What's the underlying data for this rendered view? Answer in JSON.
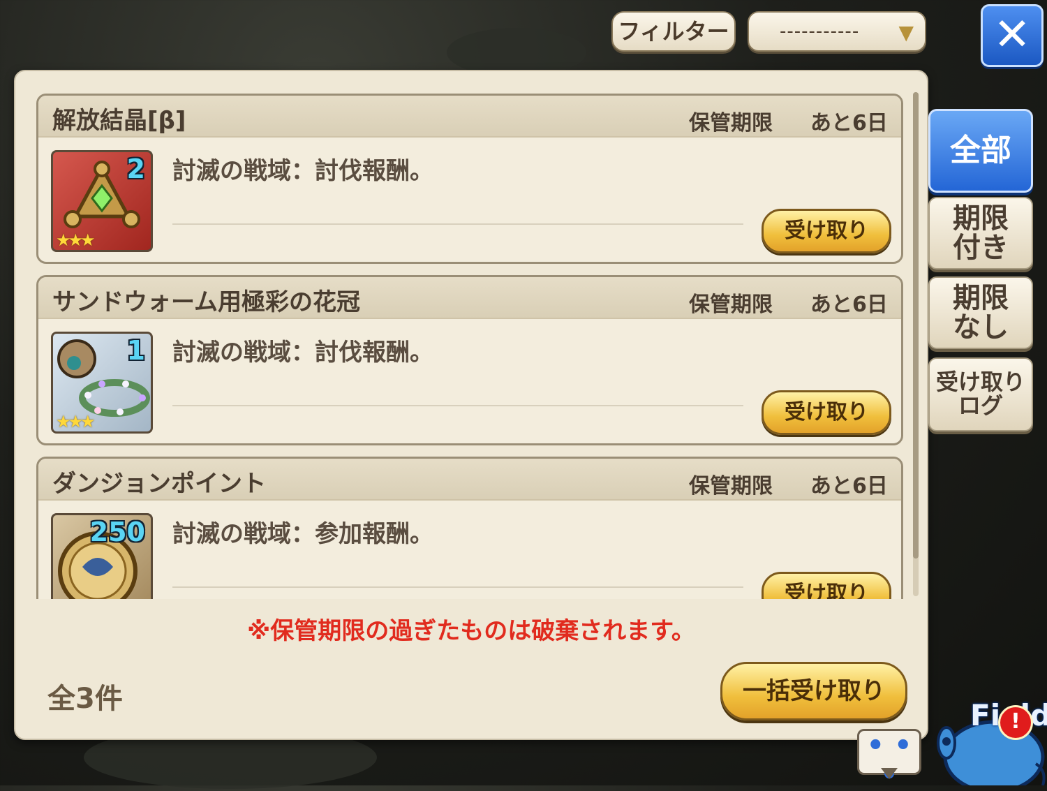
{
  "topbar": {
    "filter_label": "フィルター",
    "filter_value": "-----------",
    "close_symbol": "✕"
  },
  "items": [
    {
      "name": "解放結晶[β]",
      "expiry_label": "保管期限",
      "expiry_value": "あと6日",
      "quantity": "2",
      "rarity_stars": "★★★",
      "icon": "crystal-amulet-icon",
      "description": "討滅の戦域：討伐報酬。",
      "receive_label": "受け取り"
    },
    {
      "name": "サンドウォーム用極彩の花冠",
      "expiry_label": "保管期限",
      "expiry_value": "あと6日",
      "quantity": "1",
      "rarity_stars": "★★★",
      "icon": "flower-crown-icon",
      "description": "討滅の戦域：討伐報酬。",
      "receive_label": "受け取り"
    },
    {
      "name": "ダンジョンポイント",
      "expiry_label": "保管期限",
      "expiry_value": "あと6日",
      "quantity": "250",
      "rarity_stars": "",
      "icon": "dungeon-coin-icon",
      "description": "討滅の戦域：参加報酬。",
      "receive_label": "受け取り"
    }
  ],
  "footer": {
    "warning": "※保管期限の過ぎたものは破棄されます。",
    "total": "全3件",
    "bulk_receive_label": "一括受け取り"
  },
  "tabs": {
    "all": "全部",
    "limited": "期限\n付き",
    "unlimited": "期限\nなし",
    "log": "受け取り\nログ"
  },
  "widgets": {
    "chat_dots": "• • •",
    "field_text": "Field",
    "alert_symbol": "!"
  },
  "colors": {
    "accent_blue": "#2466d6",
    "warning_red": "#e12b1e",
    "button_gold": "#f0bf3c",
    "quantity_cyan": "#5ad4f4"
  }
}
